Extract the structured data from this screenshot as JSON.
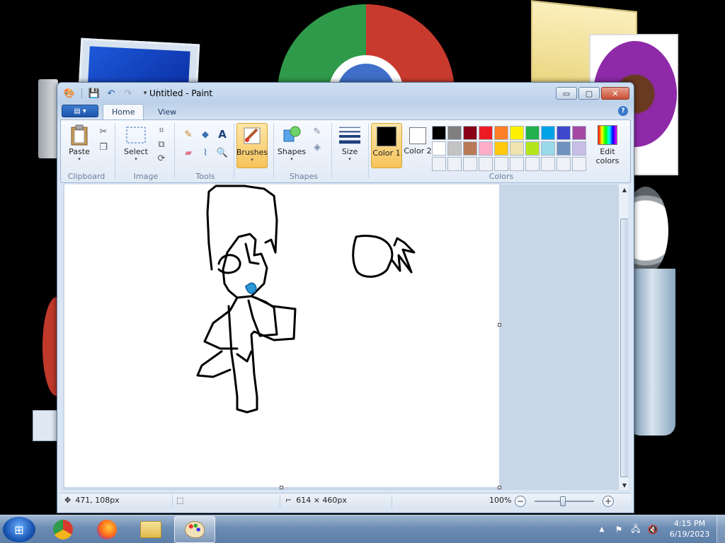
{
  "window": {
    "title": "Untitled - Paint",
    "minimize_label": "▭",
    "maximize_label": "▢",
    "close_label": "✕"
  },
  "tabs": [
    {
      "label": "Home"
    },
    {
      "label": "View"
    }
  ],
  "ribbon": {
    "clipboard": {
      "label": "Clipboard",
      "paste": "Paste"
    },
    "image": {
      "label": "Image",
      "select": "Select"
    },
    "tools": {
      "label": "Tools"
    },
    "brushes": {
      "label": "Brushes"
    },
    "shapes": {
      "label": "Shapes",
      "shapes_btn": "Shapes"
    },
    "size": {
      "label": "Size"
    },
    "colors": {
      "label": "Colors",
      "color1": "Color 1",
      "color2": "Color 2",
      "edit_colors": "Edit colors",
      "color1_value": "#000000",
      "color2_value": "#ffffff",
      "palette": [
        "#000000",
        "#7f7f7f",
        "#880015",
        "#ed1c24",
        "#ff7f27",
        "#fff200",
        "#22b14c",
        "#00a2e8",
        "#3f48cc",
        "#a349a4",
        "#ffffff",
        "#c3c3c3",
        "#b97a57",
        "#ffaec9",
        "#ffc90e",
        "#efe4b0",
        "#b5e61d",
        "#99d9ea",
        "#7092be",
        "#c8bfe7"
      ]
    }
  },
  "status": {
    "cursor_pos": "471, 108px",
    "image_size": "614 × 460px",
    "zoom": "100%"
  },
  "taskbar": {
    "time": "4:15 PM",
    "date": "6/19/2023"
  }
}
